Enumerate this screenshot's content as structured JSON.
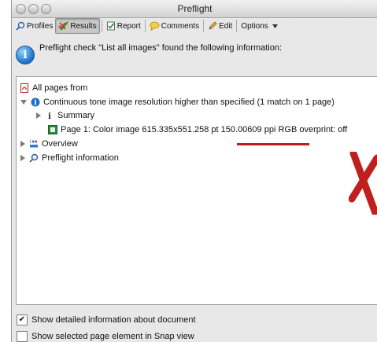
{
  "window": {
    "title": "Preflight"
  },
  "toolbar": {
    "profiles": "Profiles",
    "results": "Results",
    "report": "Report",
    "comments": "Comments",
    "edit": "Edit",
    "options": "Options"
  },
  "message": "Preflight check \"List all images\" found the following information:",
  "tree": {
    "all_pages": "All pages from",
    "continuous": "Continuous tone image resolution higher than specified (1 match on 1 page)",
    "summary": "Summary",
    "page_prefix": "Page 1: Color image 615.335x551.258 pt ",
    "page_ppi": "150.00609 ppi RGB",
    "page_suffix": " overprint: off",
    "overview": "Overview",
    "preflight_info": "Preflight information"
  },
  "options": {
    "detailed_label": "Show detailed information about document",
    "detailed_checked": true,
    "snap_label": "Show selected page element in Snap view",
    "snap_checked": false
  },
  "colors": {
    "accent_red": "#c0201d",
    "info_blue": "#1b6fc9"
  },
  "icons": [
    "magnifier-icon",
    "results-icon",
    "report-icon",
    "comments-icon",
    "edit-icon",
    "chevron-down-icon",
    "info-icon",
    "pdf-icon",
    "summary-icon",
    "image-icon",
    "overview-icon"
  ]
}
